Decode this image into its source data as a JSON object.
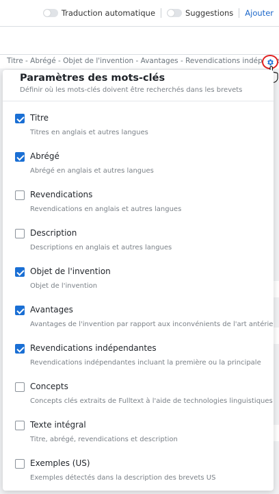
{
  "topbar": {
    "toggle_translation_label": "Traduction automatique",
    "toggle_suggestions_label": "Suggestions",
    "add_label": "Ajouter"
  },
  "summary": {
    "text": "Titre - Abrégé - Objet de l'invention - Avantages - Revendications indépendantes"
  },
  "panel": {
    "title": "Paramètres des mots-clés",
    "subtitle": "Définir où les mots-clés doivent être recherchés dans les brevets",
    "options": [
      {
        "label": "Titre",
        "description": "Titres en anglais et autres langues",
        "checked": true
      },
      {
        "label": "Abrégé",
        "description": "Abrégé en anglais et autres langues",
        "checked": true
      },
      {
        "label": "Revendications",
        "description": "Revendications en anglais et autres langues",
        "checked": false
      },
      {
        "label": "Description",
        "description": "Descriptions en anglais et autres langues",
        "checked": false
      },
      {
        "label": "Objet de l'invention",
        "description": "Objet de l'invention",
        "checked": true
      },
      {
        "label": "Avantages",
        "description": "Avantages de l'invention par rapport aux inconvénients de l'art antérieur",
        "checked": true
      },
      {
        "label": "Revendications indépendantes",
        "description": "Revendications indépendantes incluant la première ou la principale",
        "checked": true
      },
      {
        "label": "Concepts",
        "description": "Concepts clés extraits de Fulltext à l'aide de technologies linguistiques",
        "checked": false
      },
      {
        "label": "Texte intégral",
        "description": "Titre, abrégé, revendications et description",
        "checked": false
      },
      {
        "label": "Exemples (US)",
        "description": "Exemples détectés dans la description des brevets US",
        "checked": false
      }
    ]
  },
  "colors": {
    "accent": "#1a6fd4",
    "highlight_ring": "#e02020"
  },
  "icons": {
    "settings": "gear-icon",
    "pointer": "hand-cursor-icon"
  }
}
